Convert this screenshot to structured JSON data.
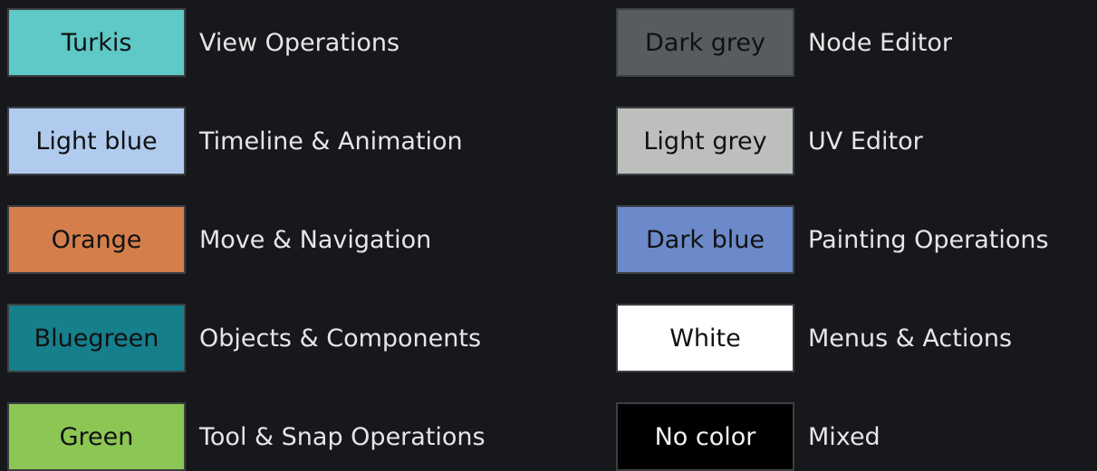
{
  "legend": {
    "left": [
      {
        "swatch_label": "Turkis",
        "swatch_color": "#5ec9c7",
        "description": "View Operations"
      },
      {
        "swatch_label": "Light blue",
        "swatch_color": "#b0cbee",
        "description": "Timeline & Animation"
      },
      {
        "swatch_label": "Orange",
        "swatch_color": "#d47e4c",
        "description": "Move & Navigation"
      },
      {
        "swatch_label": "Bluegreen",
        "swatch_color": "#167f8c",
        "description": "Objects & Components"
      },
      {
        "swatch_label": "Green",
        "swatch_color": "#8cc654",
        "description": "Tool & Snap Operations"
      }
    ],
    "right": [
      {
        "swatch_label": "Dark grey",
        "swatch_color": "#575d5f",
        "description": "Node Editor"
      },
      {
        "swatch_label": "Light grey",
        "swatch_color": "#bdbfbd",
        "description": "UV Editor"
      },
      {
        "swatch_label": "Dark blue",
        "swatch_color": "#6c8ac9",
        "description": "Painting Operations"
      },
      {
        "swatch_label": "White",
        "swatch_color": "#ffffff",
        "description": "Menus & Actions"
      },
      {
        "swatch_label": "No color",
        "swatch_color": "#000000",
        "description": "Mixed"
      }
    ]
  },
  "colors": {
    "background": "#17181c",
    "description_text": "#e6e6e6",
    "swatch_text": "#111111",
    "swatch_border": "#3c3f44"
  }
}
